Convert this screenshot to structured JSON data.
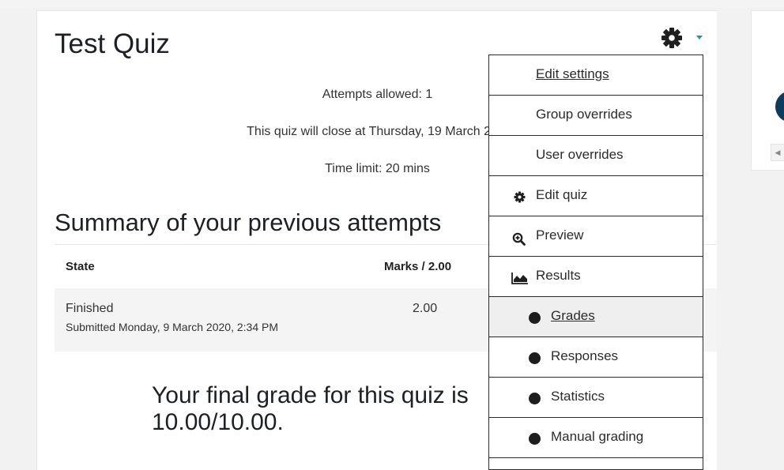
{
  "quiz": {
    "title": "Test Quiz",
    "attempts_allowed": "Attempts allowed: 1",
    "close_info": "This quiz will close at Thursday, 19 March 202",
    "time_limit": "Time limit: 20 mins"
  },
  "summary": {
    "heading": "Summary of your previous attempts",
    "columns": [
      "State",
      "Marks / 2.00"
    ],
    "rows": [
      {
        "state": "Finished",
        "submitted": "Submitted Monday, 9 March 2020, 2:34 PM",
        "marks": "2.00"
      }
    ],
    "final_grade_line1": "Your final grade for this quiz is",
    "final_grade_line2": "10.00/10.00."
  },
  "menu": {
    "items": [
      {
        "label": "Edit settings",
        "icon": "none"
      },
      {
        "label": "Group overrides",
        "icon": "none"
      },
      {
        "label": "User overrides",
        "icon": "none"
      },
      {
        "label": "Edit quiz",
        "icon": "gear-icon"
      },
      {
        "label": "Preview",
        "icon": "magnifier-plus-icon"
      },
      {
        "label": "Results",
        "icon": "area-chart-icon"
      },
      {
        "label": "Grades",
        "icon": "bullet-icon"
      },
      {
        "label": "Responses",
        "icon": "bullet-icon"
      },
      {
        "label": "Statistics",
        "icon": "bullet-icon"
      },
      {
        "label": "Manual grading",
        "icon": "bullet-icon"
      }
    ]
  },
  "colors": {
    "accent": "#2d8fa8",
    "text": "#1d2125",
    "avatar": "#0f3b5c"
  }
}
